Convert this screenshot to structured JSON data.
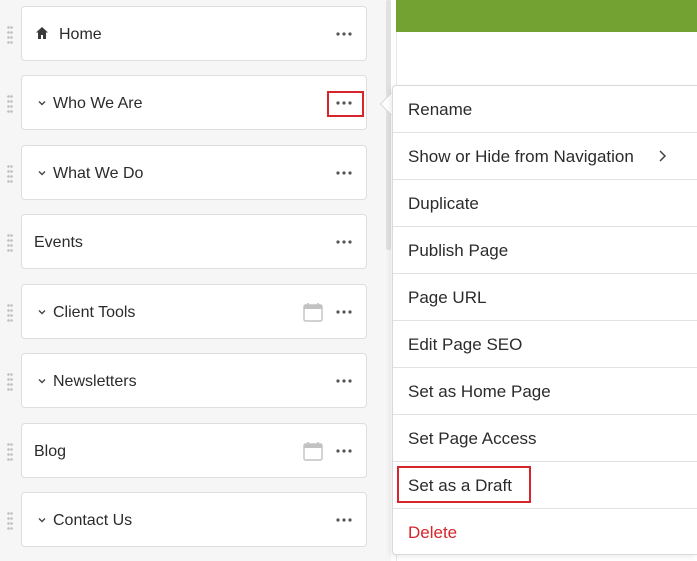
{
  "colors": {
    "accent_green": "#74a232",
    "highlight_red": "#d6252b",
    "danger_red": "#d6252b"
  },
  "pages": [
    {
      "label": "Home",
      "icon": "home-icon",
      "expandable": false,
      "has_calendar": false
    },
    {
      "label": "Who We Are",
      "icon": "chevron-down-icon",
      "expandable": true,
      "has_calendar": false
    },
    {
      "label": "What We Do",
      "icon": "chevron-down-icon",
      "expandable": true,
      "has_calendar": false
    },
    {
      "label": "Events",
      "icon": "",
      "expandable": false,
      "has_calendar": false
    },
    {
      "label": "Client Tools",
      "icon": "chevron-down-icon",
      "expandable": true,
      "has_calendar": true
    },
    {
      "label": "Newsletters",
      "icon": "chevron-down-icon",
      "expandable": true,
      "has_calendar": false
    },
    {
      "label": "Blog",
      "icon": "",
      "expandable": false,
      "has_calendar": true
    },
    {
      "label": "Contact Us",
      "icon": "chevron-down-icon",
      "expandable": true,
      "has_calendar": false
    }
  ],
  "context_menu": {
    "items": [
      {
        "label": "Rename"
      },
      {
        "label": "Show or Hide from Navigation",
        "has_submenu": true
      },
      {
        "label": "Duplicate"
      },
      {
        "label": "Publish Page"
      },
      {
        "label": "Page URL"
      },
      {
        "label": "Edit Page SEO"
      },
      {
        "label": "Set as Home Page"
      },
      {
        "label": "Set Page Access"
      },
      {
        "label": "Set as a Draft",
        "highlighted": true
      },
      {
        "label": "Delete",
        "danger": true
      }
    ]
  }
}
